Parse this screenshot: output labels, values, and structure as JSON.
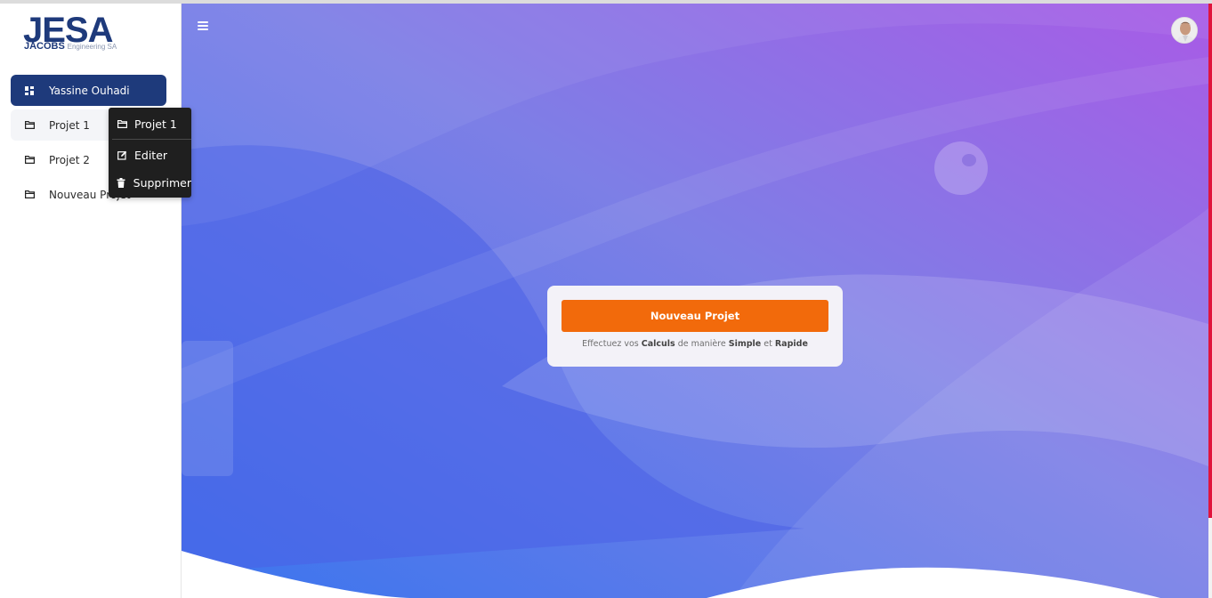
{
  "logo": {
    "main": "JESA",
    "sub_bold": "JACOBS",
    "sub_text": "Engineering SA"
  },
  "sidebar": {
    "items": [
      {
        "label": "Yassine Ouhadi",
        "icon": "dashboard-icon",
        "state": "active"
      },
      {
        "label": "Projet 1",
        "icon": "folder-icon",
        "state": "hover"
      },
      {
        "label": "Projet 2",
        "icon": "folder-icon",
        "state": "normal"
      },
      {
        "label": "Nouveau Projet",
        "icon": "folder-icon",
        "state": "normal"
      }
    ]
  },
  "popup": {
    "title": "Projet 1",
    "actions": [
      {
        "label": "Editer",
        "icon": "edit-icon"
      },
      {
        "label": "Supprimer",
        "icon": "trash-icon"
      }
    ]
  },
  "card": {
    "button_label": "Nouveau Projet",
    "tagline": {
      "p1": "Effectuez vos ",
      "b1": "Calculs",
      "p2": " de manière ",
      "b2": "Simple",
      "p3": " et ",
      "b3": "Rapide"
    }
  },
  "colors": {
    "brand": "#1e3a7b",
    "cta": "#f26a0b",
    "gradient_start": "#3d74ec",
    "gradient_end": "#a85be6",
    "accent_bar": "#e0143c"
  }
}
